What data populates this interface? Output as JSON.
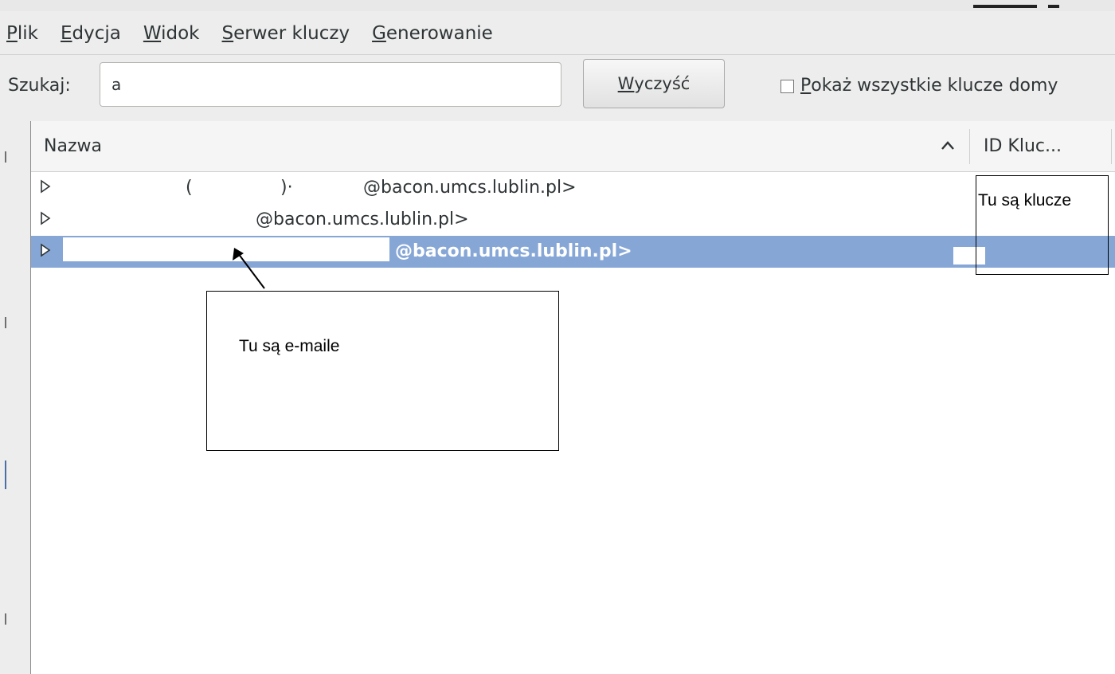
{
  "menu": {
    "items": [
      {
        "mnemonic": "P",
        "rest": "lik"
      },
      {
        "mnemonic": "E",
        "rest": "dycja"
      },
      {
        "mnemonic": "W",
        "rest": "idok"
      },
      {
        "mnemonic": "S",
        "rest": "erwer kluczy"
      },
      {
        "mnemonic": "G",
        "rest": "enerowanie"
      }
    ]
  },
  "search": {
    "label": "Szukaj:",
    "value": "a",
    "clear_mnemonic": "W",
    "clear_rest": "yczyść",
    "show_all_mnemonic": "P",
    "show_all_rest": "okaż wszystkie klucze domy",
    "show_all_checked": false
  },
  "list": {
    "columns": {
      "name": "Nazwa",
      "id": "ID Kluc..."
    },
    "rows": [
      {
        "fragments": [
          "(",
          ")·",
          "@bacon.umcs.lublin.pl>"
        ],
        "selected": false
      },
      {
        "fragments": [
          "@bacon.umcs.lublin.pl>"
        ],
        "selected": false
      },
      {
        "fragments": [
          "@bacon.umcs.lublin.pl>"
        ],
        "selected": true
      }
    ]
  },
  "annotations": {
    "keys_note": "Tu są klucze",
    "emails_note": "Tu są e-maile"
  },
  "colors": {
    "selection": "#86a6d6",
    "window_bg": "#ededed"
  }
}
